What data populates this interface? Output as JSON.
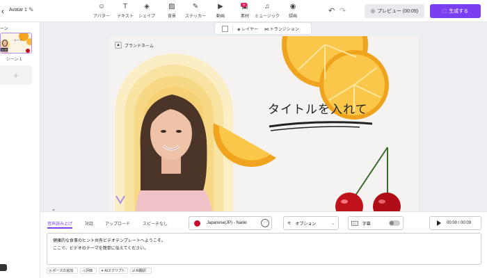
{
  "topbar": {
    "title": "Avatar 1",
    "tools": [
      {
        "label": "アバター",
        "icon": "avatar-icon",
        "glyph": "☺"
      },
      {
        "label": "テキスト",
        "icon": "text-icon",
        "glyph": "T"
      },
      {
        "label": "シェイプ",
        "icon": "shape-icon",
        "glyph": "◈"
      },
      {
        "label": "背景",
        "icon": "background-icon",
        "glyph": "▨"
      },
      {
        "label": "ステッカー",
        "icon": "sticker-icon",
        "glyph": "✎"
      },
      {
        "label": "動画",
        "icon": "video-icon",
        "glyph": "▶"
      },
      {
        "label": "素材",
        "icon": "media-icon",
        "glyph": "▣"
      },
      {
        "label": "ミュージック",
        "icon": "music-icon",
        "glyph": "♫"
      },
      {
        "label": "録画",
        "icon": "record-icon",
        "glyph": "◉"
      }
    ],
    "new_badge": "N",
    "preview_label": "プレビュー (00:09)",
    "generate_label": "生成する"
  },
  "scenes": {
    "panel_label": "ーン",
    "items": [
      {
        "name": "シーン 1",
        "duration": "0:09",
        "thumb_label": "シーン"
      }
    ],
    "add_glyph": "+"
  },
  "canvas_toolbar": {
    "layer": "レイヤー",
    "transition": "トランジション"
  },
  "canvas": {
    "brand_name": "ブランドネーム",
    "headline": "タイトルを入れて"
  },
  "bottom": {
    "tabs": [
      "音声読み上げ",
      "対話",
      "アップロード",
      "スピーチなし"
    ],
    "voice": "Japanese(JP) - Naoki",
    "options": "オプション",
    "subtitles": "字幕",
    "cc": "CC",
    "time": "00:00 / 00:09",
    "script_lines": [
      "健康的な食事のヒント共有ビデオテンプレートへようこそ。",
      "ここで、ビデオのテーマを簡単に伝えてください。"
    ],
    "chips": [
      "ポーズの追加",
      "評価",
      "AIスクリプト",
      "AI翻訳"
    ]
  },
  "colors": {
    "accent": "#7b3ff2",
    "orange": "#f5a31a",
    "cherry": "#c0121b"
  }
}
